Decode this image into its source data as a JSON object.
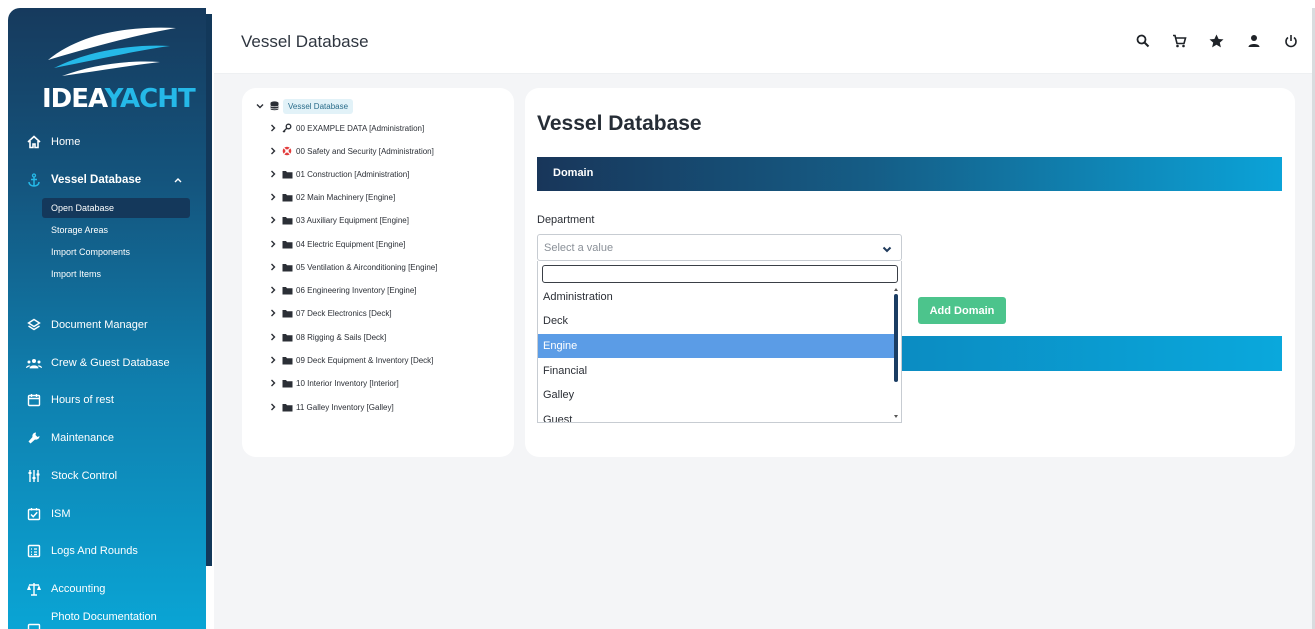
{
  "brand": {
    "logo_part1": "IDEA",
    "logo_part2": "YACHT",
    "accent_color": "#25b9e8"
  },
  "sidebar": {
    "items": [
      {
        "label": "Home",
        "icon": "home-icon"
      },
      {
        "label": "Vessel Database",
        "icon": "anchor-icon",
        "active": true
      },
      {
        "label": "Document Manager",
        "icon": "layers-icon"
      },
      {
        "label": "Crew & Guest Database",
        "icon": "group-icon"
      },
      {
        "label": "Hours of rest",
        "icon": "calendar-icon"
      },
      {
        "label": "Maintenance",
        "icon": "wrench-icon"
      },
      {
        "label": "Stock Control",
        "icon": "sliders-icon"
      },
      {
        "label": "ISM",
        "icon": "checkbox-icon"
      },
      {
        "label": "Logs And Rounds",
        "icon": "clipboard-icon"
      },
      {
        "label": "Accounting",
        "icon": "scales-icon"
      },
      {
        "label": "Photo Documentation",
        "icon": "photo-icon"
      }
    ],
    "subitems": [
      {
        "label": "Open Database",
        "selected": true
      },
      {
        "label": "Storage Areas"
      },
      {
        "label": "Import Components"
      },
      {
        "label": "Import Items"
      }
    ]
  },
  "header": {
    "title": "Vessel Database",
    "icons": [
      "search-icon",
      "cart-icon",
      "star-icon",
      "user-icon",
      "power-icon"
    ]
  },
  "tree": {
    "root": "Vessel Database",
    "nodes": [
      {
        "label": "00 EXAMPLE DATA [Administration]",
        "icon": "key-icon"
      },
      {
        "label": "00 Safety and Security [Administration]",
        "icon": "lifebuoy-icon"
      },
      {
        "label": "01 Construction [Administration]",
        "icon": "folder-icon"
      },
      {
        "label": "02 Main Machinery [Engine]",
        "icon": "folder-icon"
      },
      {
        "label": "03 Auxiliary Equipment [Engine]",
        "icon": "folder-icon"
      },
      {
        "label": "04 Electric Equipment [Engine]",
        "icon": "folder-icon"
      },
      {
        "label": "05 Ventilation & Airconditioning [Engine]",
        "icon": "folder-icon"
      },
      {
        "label": "06 Engineering Inventory [Engine]",
        "icon": "folder-icon"
      },
      {
        "label": "07 Deck Electronics [Deck]",
        "icon": "folder-icon"
      },
      {
        "label": "08 Rigging & Sails [Deck]",
        "icon": "folder-icon"
      },
      {
        "label": "09 Deck Equipment & Inventory [Deck]",
        "icon": "folder-icon"
      },
      {
        "label": "10 Interior Inventory [Interior]",
        "icon": "folder-icon"
      },
      {
        "label": "11 Galley Inventory [Galley]",
        "icon": "folder-icon"
      }
    ]
  },
  "form": {
    "title": "Vessel Database",
    "section": "Domain",
    "department_label": "Department",
    "select_placeholder": "Select a value",
    "search_value": "",
    "options": [
      "Administration",
      "Deck",
      "Engine",
      "Financial",
      "Galley",
      "Guest"
    ],
    "highlighted": "Engine",
    "add_button": "Add Domain"
  }
}
